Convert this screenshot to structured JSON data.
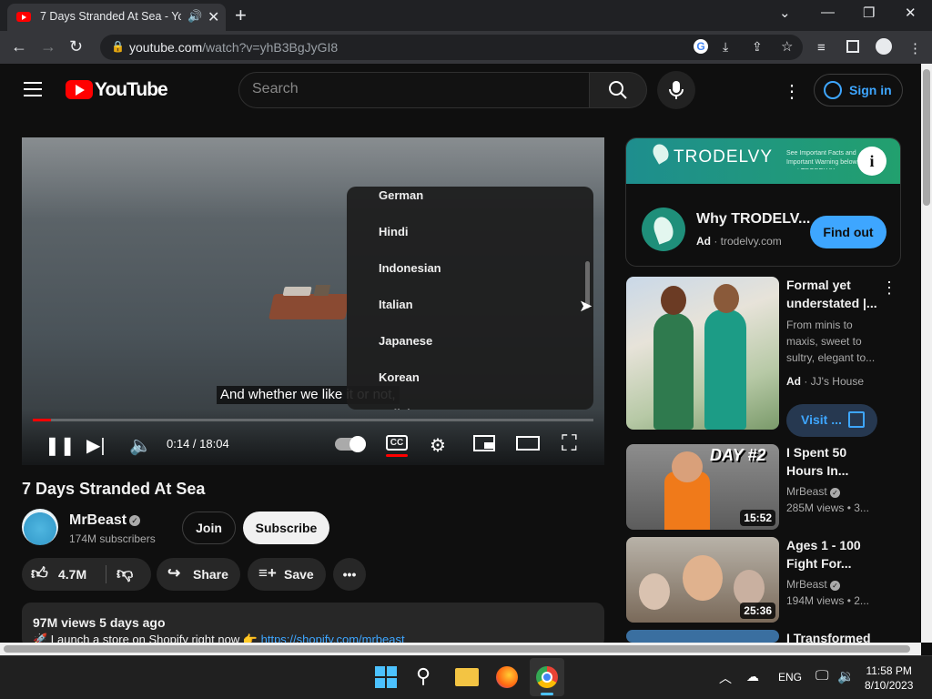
{
  "browser": {
    "tab_title": "7 Days Stranded At Sea - YouTube",
    "url_host": "youtube.com",
    "url_path": "/watch?v=yhB3BgJyGI8"
  },
  "youtube": {
    "logo_text": "YouTube",
    "search_placeholder": "Search",
    "sign_in": "Sign in"
  },
  "player": {
    "caption": "And whether we like it or not,",
    "time": "0:14 / 18:04",
    "progress_fraction": 0.013,
    "subtitle_languages": [
      "German",
      "Hindi",
      "Indonesian",
      "Italian",
      "Japanese",
      "Korean",
      "Polish"
    ]
  },
  "video": {
    "title": "7 Days Stranded At Sea",
    "channel": "MrBeast",
    "subscribers": "174M subscribers",
    "join": "Join",
    "subscribe": "Subscribe",
    "likes": "4.7M",
    "share": "Share",
    "save": "Save",
    "views": "97M views  5 days ago",
    "desc_line": "🚀 Launch a store on Shopify right now 👉 ",
    "desc_link": "https://shopify.com/mrbeast"
  },
  "ad": {
    "banner_brand": "TRODELVY",
    "banner_small": "See Important Facts and Important Warning below or at TRODELVY",
    "title": "Why TRODELV...",
    "badge": "Ad",
    "domain": "· trodelvy.com",
    "cta": "Find out"
  },
  "suggestions": [
    {
      "title1": "Formal yet",
      "title2": "understated |...",
      "desc": [
        "From minis to",
        "maxis, sweet to",
        "sultry, elegant to..."
      ],
      "badge": "Ad",
      "channel": "· JJ's House",
      "cta": "Visit ..."
    },
    {
      "title1": "I Spent 50",
      "title2": "Hours In...",
      "channel": "MrBeast",
      "views": "285M views",
      "age": "• 3...",
      "duration": "15:52",
      "thumb_text": "DAY #2"
    },
    {
      "title1": "Ages 1 - 100",
      "title2": "Fight For...",
      "channel": "MrBeast",
      "views": "194M views",
      "age": "• 2...",
      "duration": "25:36"
    },
    {
      "title1": "I Transformed"
    }
  ],
  "taskbar": {
    "lang": "ENG",
    "time": "11:58 PM",
    "date": "8/10/2023"
  },
  "colors": {
    "accent": "#ff0000",
    "link": "#3ea6ff",
    "bg": "#0f0f0f"
  }
}
